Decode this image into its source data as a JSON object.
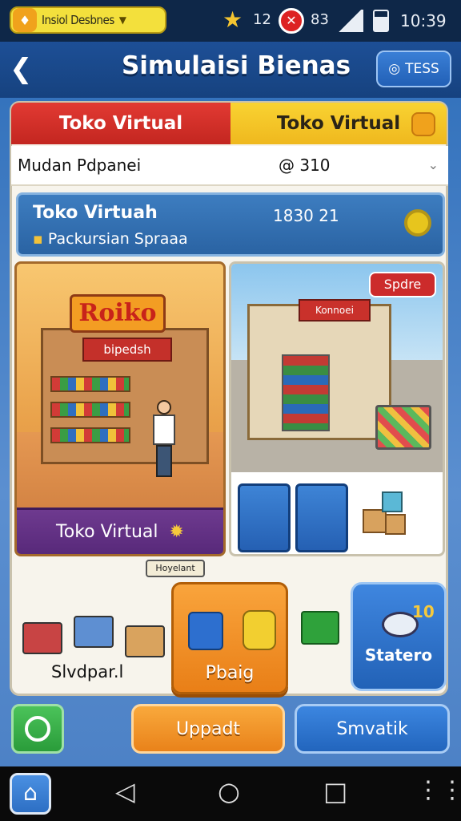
{
  "status_bar": {
    "pill_label": "Insiol Desbnes",
    "notif_count": "12",
    "signal_text": "83",
    "time": "10:39"
  },
  "header": {
    "title": "Simulaisi Bienas",
    "right_button_label": "TESS"
  },
  "tabs": [
    {
      "label": "Toko Virtual",
      "active": true
    },
    {
      "label": "Toko Virtual",
      "active": false
    }
  ],
  "selector": {
    "left_label": "Mudan Pdpanei",
    "mid_value": "@ 310"
  },
  "info_card": {
    "title": "Toko Virtuah",
    "value": "1830 21",
    "subtitle": "Packursian Spraaa"
  },
  "left_scene": {
    "logo": "Roiko",
    "banner": "bipedsh",
    "footer_label": "Toko Virtual"
  },
  "right_scene": {
    "tag": "Spdre",
    "sign": "Konnoei"
  },
  "sticker": "Hoyelant",
  "items": {
    "label": "Slvdpar.l",
    "pack_label": "Pbaig",
    "stat_label": "Statero",
    "stat_badge": "10"
  },
  "actions": {
    "orange_label": "Uppadt",
    "blue_label": "Smvatik"
  },
  "colors": {
    "primary_blue": "#2262b7",
    "accent_orange": "#e97f17",
    "tab_red": "#c32620",
    "tab_yellow": "#efb81e"
  }
}
